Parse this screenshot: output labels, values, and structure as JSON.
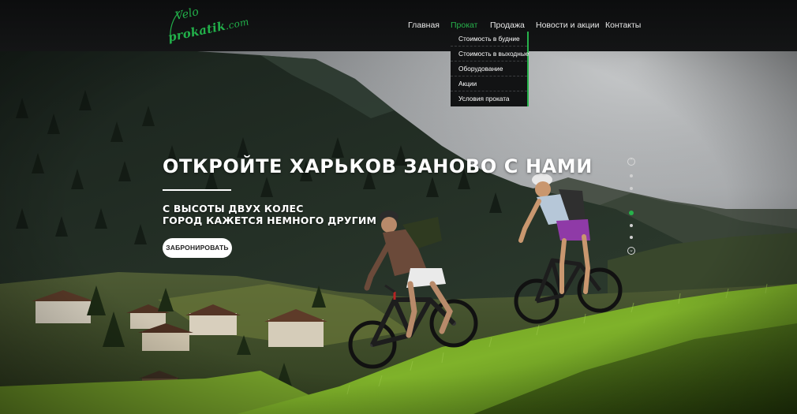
{
  "logo": {
    "line1": "Velo",
    "line2_main": "prokatik",
    "line2_tail": ".com"
  },
  "nav": {
    "items": [
      {
        "label": "Главная",
        "active": false
      },
      {
        "label": "Прокат",
        "active": true
      },
      {
        "label": "Продажа",
        "active": false
      },
      {
        "label": "Новости и акции",
        "active": false
      },
      {
        "label": "Контакты",
        "active": false
      }
    ]
  },
  "dropdown": {
    "items": [
      "Стоимость в будние",
      "Стоимость в выходные",
      "Оборудование",
      "Акции",
      "Условия проката"
    ]
  },
  "hero": {
    "headline": "ОТКРОЙТЕ ХАРЬКОВ ЗАНОВО С НАМИ",
    "subtitle_line1": "С ВЫСОТЫ ДВУХ КОЛЕС",
    "subtitle_line2": "ГОРОД КАЖЕТСЯ НЕМНОГО ДРУГИМ",
    "button_label": "ЗАБРОНИРОВАТЬ"
  },
  "slider": {
    "up_icon": "chevron-up-icon",
    "down_icon": "chevron-down-icon",
    "dot_count": 5,
    "active_index": 2
  },
  "colors": {
    "accent": "#27b24b",
    "header_bg": "#111213",
    "dropdown_bg": "#121314"
  }
}
